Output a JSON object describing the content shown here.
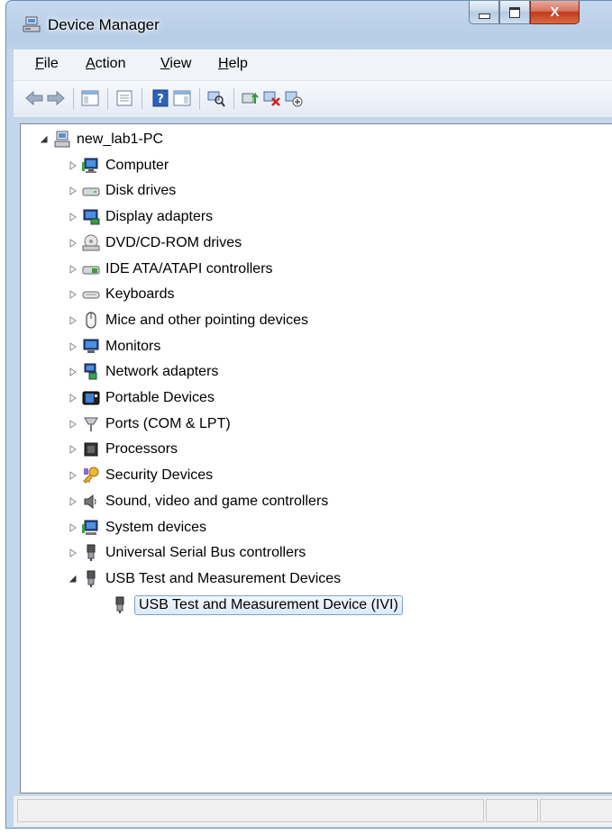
{
  "window": {
    "title": "Device Manager",
    "close_glyph": "X"
  },
  "menu": [
    {
      "name": "file",
      "label": "File",
      "accel": "F",
      "rest": "ile"
    },
    {
      "name": "action",
      "label": "Action",
      "accel": "A",
      "rest": "ction"
    },
    {
      "name": "view",
      "label": "View",
      "accel": "V",
      "rest": "iew"
    },
    {
      "name": "help",
      "label": "Help",
      "accel": "H",
      "rest": "elp"
    }
  ],
  "toolbar": {
    "icons": [
      "back-arrow-icon",
      "forward-arrow-icon",
      "show-hide-console-tree-icon",
      "properties-icon",
      "help-icon",
      "action-pane-icon",
      "scan-hardware-icon",
      "update-driver-icon",
      "uninstall-icon",
      "disable-device-icon"
    ]
  },
  "tree": {
    "root": {
      "label": "new_lab1-PC",
      "icon": "computer-network-icon",
      "expanded": true
    },
    "categories": [
      {
        "label": "Computer",
        "icon": "computer-icon",
        "expanded": false
      },
      {
        "label": "Disk drives",
        "icon": "disk-drive-icon",
        "expanded": false
      },
      {
        "label": "Display adapters",
        "icon": "display-adapter-icon",
        "expanded": false
      },
      {
        "label": "DVD/CD-ROM drives",
        "icon": "dvd-drive-icon",
        "expanded": false
      },
      {
        "label": "IDE ATA/ATAPI controllers",
        "icon": "ide-controller-icon",
        "expanded": false
      },
      {
        "label": "Keyboards",
        "icon": "keyboard-icon",
        "expanded": false
      },
      {
        "label": "Mice and other pointing devices",
        "icon": "mouse-icon",
        "expanded": false
      },
      {
        "label": "Monitors",
        "icon": "monitor-icon",
        "expanded": false
      },
      {
        "label": "Network adapters",
        "icon": "network-adapter-icon",
        "expanded": false
      },
      {
        "label": "Portable Devices",
        "icon": "portable-device-icon",
        "expanded": false
      },
      {
        "label": "Ports (COM & LPT)",
        "icon": "port-icon",
        "expanded": false
      },
      {
        "label": "Processors",
        "icon": "processor-icon",
        "expanded": false
      },
      {
        "label": "Security Devices",
        "icon": "security-key-icon",
        "expanded": false
      },
      {
        "label": "Sound, video and game controllers",
        "icon": "speaker-icon",
        "expanded": false
      },
      {
        "label": "System devices",
        "icon": "system-device-icon",
        "expanded": false
      },
      {
        "label": "Universal Serial Bus controllers",
        "icon": "usb-plug-icon",
        "expanded": false
      },
      {
        "label": "USB Test and Measurement Devices",
        "icon": "usb-plug-icon",
        "expanded": true,
        "children": [
          {
            "label": "USB Test and Measurement Device (IVI)",
            "icon": "usb-plug-icon",
            "selected": true
          }
        ]
      }
    ]
  },
  "colors": {
    "selection_border": "#7da2ce",
    "selection_fill": "#dbe9f9",
    "title_gradient_top": "#c5d8ee",
    "close_button": "#c23b1b"
  }
}
